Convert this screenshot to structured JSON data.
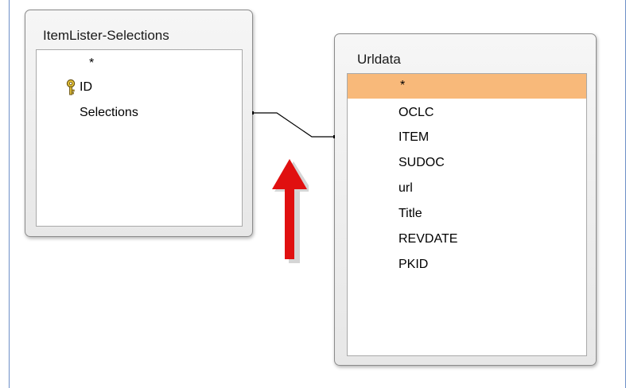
{
  "left_table": {
    "title": "ItemLister-Selections",
    "fields": [
      {
        "label": "*",
        "primary_key": false
      },
      {
        "label": "ID",
        "primary_key": true
      },
      {
        "label": "Selections",
        "primary_key": false
      }
    ]
  },
  "right_table": {
    "title": "Urldata",
    "fields": [
      {
        "label": "*",
        "selected": true
      },
      {
        "label": "OCLC"
      },
      {
        "label": "ITEM"
      },
      {
        "label": "SUDOC"
      },
      {
        "label": "url"
      },
      {
        "label": "Title"
      },
      {
        "label": "REVDATE"
      },
      {
        "label": "PKID"
      }
    ]
  },
  "colors": {
    "selected_row": "#f8b97a",
    "arrow": "#e01010",
    "frame_border": "#6d8fc7"
  },
  "icons": {
    "primary_key": "key-icon",
    "annotation": "up-arrow-icon"
  }
}
